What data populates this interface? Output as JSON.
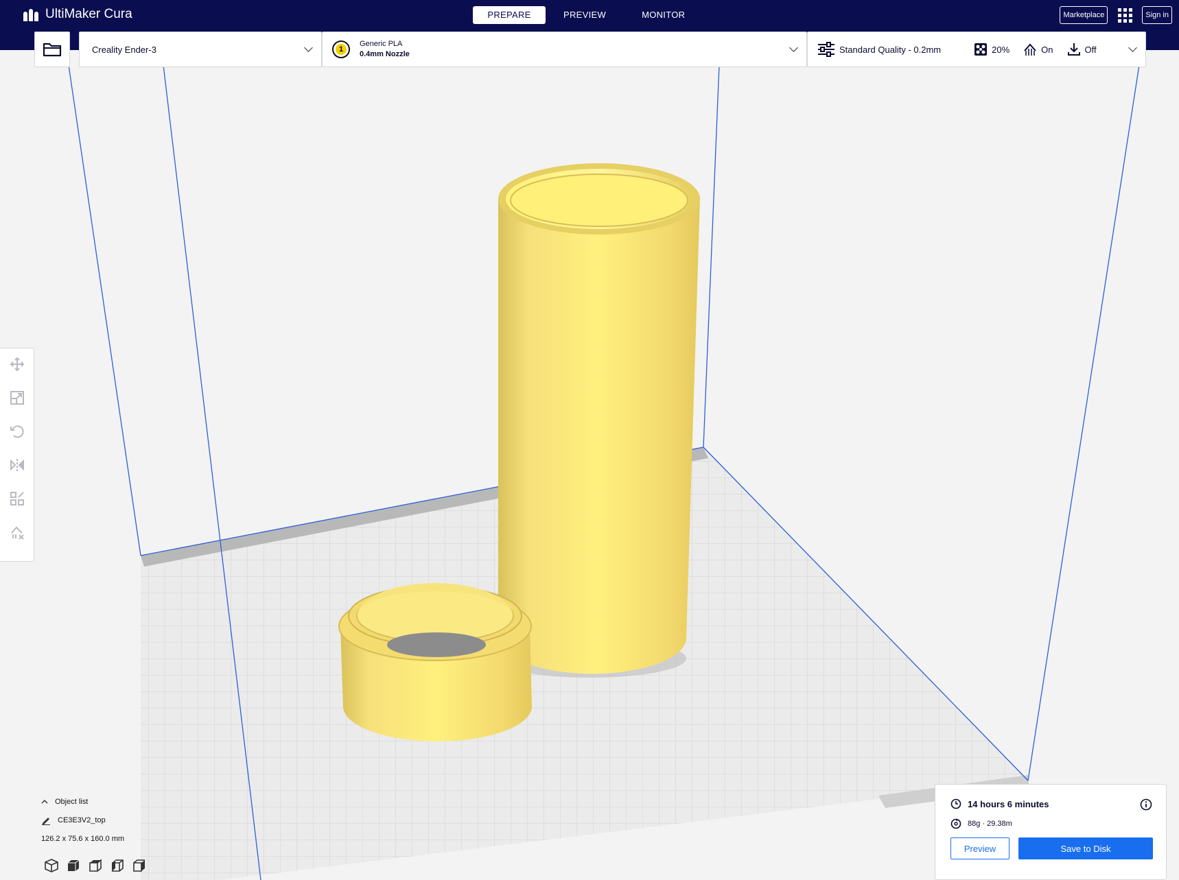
{
  "app": {
    "title": "UltiMaker Cura"
  },
  "nav": {
    "tabs": [
      {
        "label": "PREPARE",
        "active": true
      },
      {
        "label": "PREVIEW",
        "active": false
      },
      {
        "label": "MONITOR",
        "active": false
      }
    ]
  },
  "header": {
    "marketplace_label": "Marketplace",
    "signin_label": "Sign in"
  },
  "printer": {
    "name": "Creality Ender-3"
  },
  "material": {
    "extruder_number": "1",
    "name": "Generic PLA",
    "nozzle": "0.4mm Nozzle",
    "color": "#f5d000"
  },
  "settings": {
    "profile": "Standard Quality - 0.2mm",
    "infill": "20%",
    "support": "On",
    "adhesion": "Off"
  },
  "object_list": {
    "title": "Object list",
    "object_name": "CE3E3V2_top",
    "dimensions": "126.2 x 75.6 x 160.0 mm"
  },
  "print_panel": {
    "time": "14 hours 6 minutes",
    "material_usage": "88g · 29.38m",
    "preview_label": "Preview",
    "save_label": "Save to Disk"
  },
  "icons": [
    "folder-icon",
    "move-icon",
    "scale-icon",
    "rotate-icon",
    "mirror-icon",
    "per-model-settings-icon",
    "support-blocker-icon",
    "3d-view-icon",
    "front-view-icon",
    "top-view-icon",
    "left-view-icon",
    "right-view-icon",
    "clock-icon",
    "spool-icon",
    "info-icon",
    "infill-icon",
    "support-icon",
    "adhesion-icon",
    "settings-sliders-icon"
  ],
  "colors": {
    "header": "#0a0d4f",
    "accent": "#196ef0",
    "model": "#f6e27a",
    "build_volume": "#2b5fd9"
  }
}
